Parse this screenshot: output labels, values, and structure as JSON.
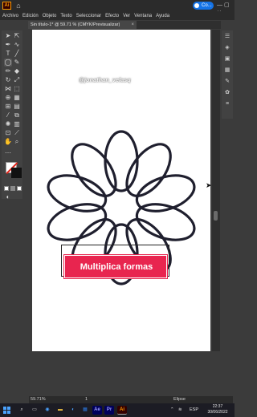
{
  "app": {
    "logo": "Ai",
    "share_label": "Co...",
    "window_controls": "— ▢ ✕"
  },
  "menu": {
    "items": [
      "Archivo",
      "Edición",
      "Objeto",
      "Texto",
      "Seleccionar",
      "Efecto",
      "Ver",
      "Ventana",
      "Ayuda"
    ]
  },
  "document_tab": {
    "title": "Sin título-1* @ 59.71 % (CMYK/Previsualizar)",
    "close": "×"
  },
  "canvas": {
    "watermark": "@jonathan_velasq",
    "caption": "Multiplica formas",
    "stroke_color": "#1f1f2e",
    "caption_color": "#e8254f"
  },
  "status": {
    "zoom": "59.71%",
    "page": "1",
    "tool": "Elipse"
  },
  "taskbar": {
    "apps": [
      {
        "label": "Ae",
        "color": "#00005b",
        "text_color": "#9999ff"
      },
      {
        "label": "Pr",
        "color": "#00005b",
        "text_color": "#9999ff"
      },
      {
        "label": "Ai",
        "color": "#330000",
        "text_color": "#ff9a00"
      }
    ],
    "language": "ESP",
    "time": "22:37",
    "date": "30/06/2022"
  },
  "icons": [
    "home-icon",
    "selection-tool-icon",
    "direct-selection-icon",
    "pen-tool-icon",
    "type-tool-icon",
    "line-tool-icon",
    "ellipse-tool-icon",
    "brush-tool-icon",
    "pencil-tool-icon",
    "eraser-tool-icon",
    "rotate-tool-icon",
    "scale-tool-icon",
    "width-tool-icon",
    "free-transform-icon",
    "shape-builder-icon",
    "perspective-icon",
    "mesh-icon",
    "gradient-icon",
    "eyedropper-icon",
    "blend-icon",
    "symbol-sprayer-icon",
    "graph-icon",
    "artboard-icon",
    "slice-icon",
    "hand-tool-icon",
    "zoom-tool-icon"
  ]
}
